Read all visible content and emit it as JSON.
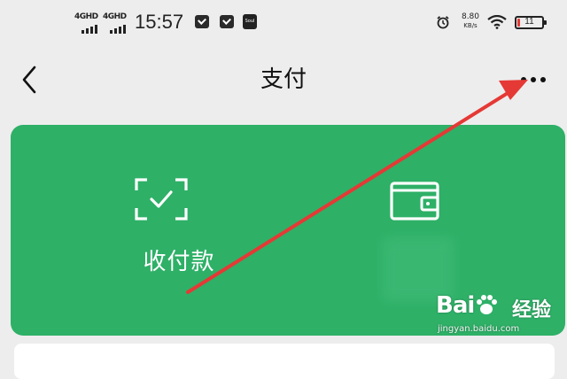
{
  "status_bar": {
    "sim1_network": "4GHD",
    "sim2_network": "4GHD",
    "time": "15:57",
    "app_badge": "Soul",
    "net_speed_value": "8.80",
    "net_speed_unit": "KB/s",
    "battery_level": "11"
  },
  "nav": {
    "title": "支付"
  },
  "pay_card": {
    "color": "#2eb067",
    "collect_label": "收付款",
    "wallet_label": ""
  },
  "annotation": {
    "arrow_color": "#e53935"
  },
  "watermark": {
    "brand": "Bai",
    "product": "经验",
    "url": "jingyan.baidu.com"
  }
}
